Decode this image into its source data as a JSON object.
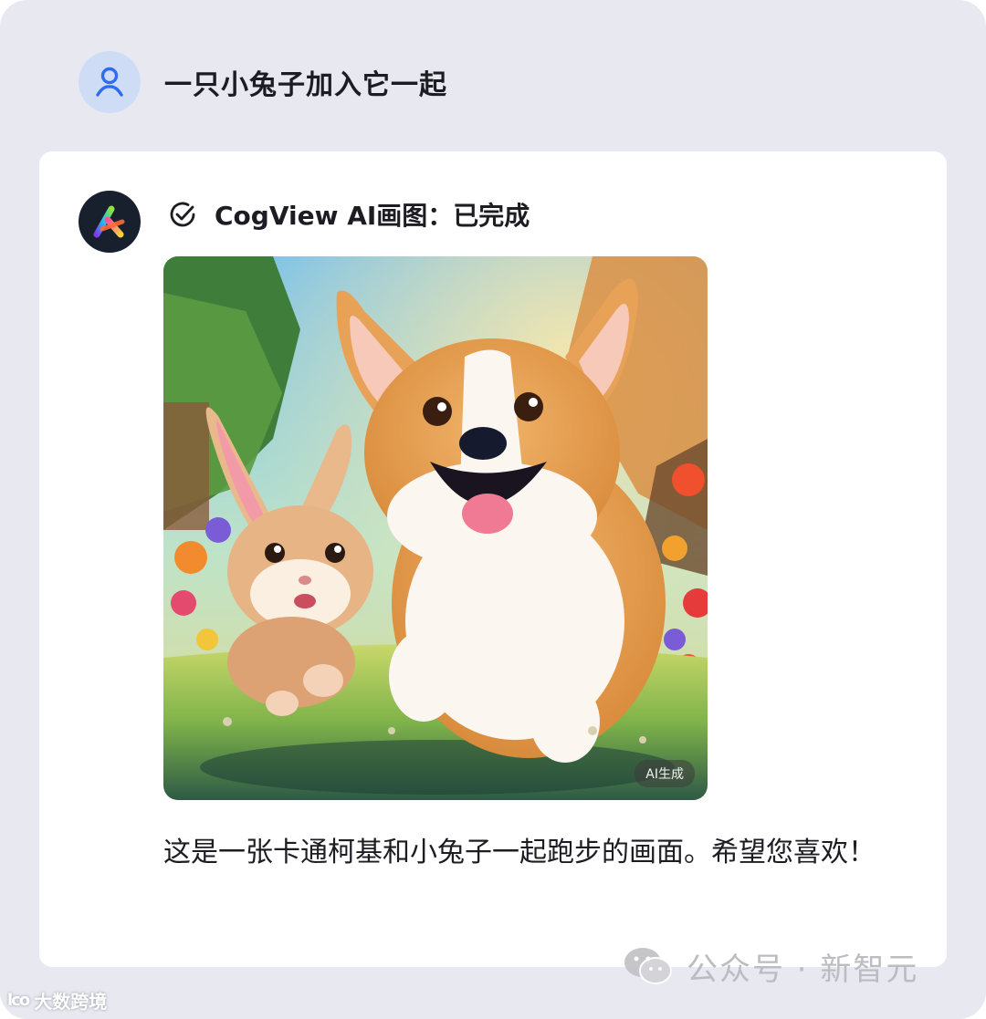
{
  "user_message": {
    "text": "一只小兔子加入它一起"
  },
  "bot": {
    "status_label": "CogView AI画图：已完成",
    "image_badge": "AI生成",
    "reply_text": "这是一张卡通柯基和小兔子一起跑步的画面。希望您喜欢！"
  },
  "watermark": {
    "text": "公众号 · 新智元",
    "corner": "大数跨境"
  },
  "icons": {
    "user_avatar": "user-outline-icon",
    "bot_avatar": "zhipu-logo-icon",
    "status": "check-circle-icon",
    "watermark": "wechat-icon"
  },
  "colors": {
    "page_bg": "#e7e8f0",
    "card_bg": "#ffffff",
    "accent_blue": "#2f6bef",
    "text": "#1c1c22"
  }
}
